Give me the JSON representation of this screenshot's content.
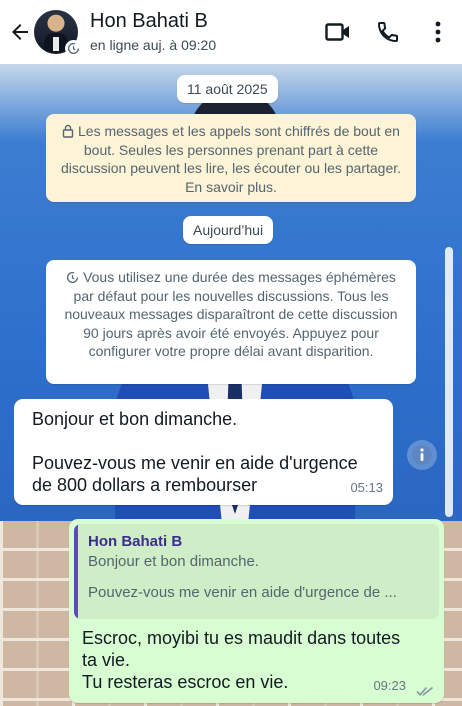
{
  "header": {
    "contact_name": "Hon Bahati B",
    "status": "en ligne auj. à 09:20",
    "icons": [
      "back-arrow-icon",
      "video-call-icon",
      "phone-icon",
      "more-vertical-icon"
    ]
  },
  "chat": {
    "date_chip": "11 août 2025",
    "encryption_notice": "Les messages et les appels sont chiffrés de bout en bout. Seules les personnes prenant part à cette discussion peuvent les lire, les écouter ou les partager. En savoir plus.",
    "today_chip": "Aujourd’hui",
    "ephemeral_notice": "Vous utilisez une durée des messages éphémères par défaut pour les nouvelles discussions. Tous les nouveaux messages disparaîtront de cette discussion 90 jours après avoir été envoyés. Appuyez pour configurer votre propre délai avant disparition."
  },
  "incoming": {
    "line1": "Bonjour et bon dimanche.",
    "line2": "Pouvez-vous me venir en aide d'urgence",
    "line3": "de 800 dollars a rembourser",
    "time": "05:13"
  },
  "outgoing": {
    "quote_name": "Hon Bahati B",
    "quote_line1": "Bonjour et bon dimanche.",
    "quote_line2": "Pouvez-vous me venir en aide d'urgence de ...",
    "line1": "Escroc, moyibi tu es maudit dans toutes",
    "line2": "ta vie.",
    "line3": "Tu resteras escroc en vie.",
    "time": "09:23",
    "status": "read"
  },
  "colors": {
    "incoming_bubble": "#ffffff",
    "outgoing_bubble": "#d9fdd3",
    "encryption_notice_bg": "#fdf3d7",
    "quote_bar": "#5f4bb6"
  }
}
